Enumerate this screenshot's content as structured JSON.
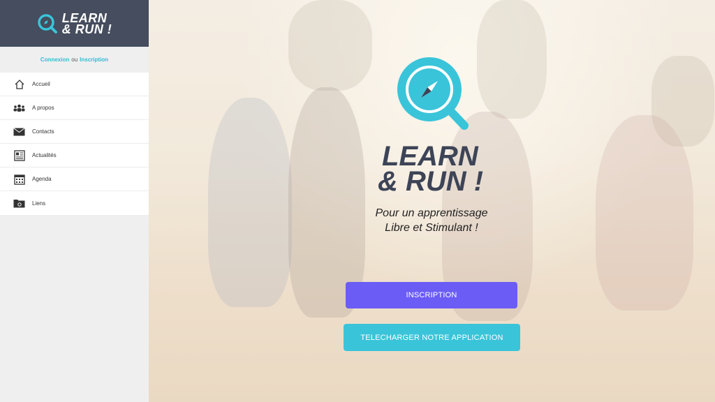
{
  "brand": {
    "line1": "LEARN",
    "line2": "& RUN !"
  },
  "auth": {
    "login": "Connexion",
    "or": "ou",
    "register": "Inscription"
  },
  "nav": [
    {
      "label": "Accueil",
      "icon": "home-icon"
    },
    {
      "label": "A propos",
      "icon": "users-icon"
    },
    {
      "label": "Contacts",
      "icon": "envelope-icon"
    },
    {
      "label": "Actualités",
      "icon": "newspaper-icon"
    },
    {
      "label": "Agenda",
      "icon": "calendar-icon"
    },
    {
      "label": "Liens",
      "icon": "folder-link-icon"
    }
  ],
  "hero": {
    "title_line1": "LEARN",
    "title_line2": "& RUN !",
    "tagline_line1": "Pour un apprentissage",
    "tagline_line2": "Libre et Stimulant !",
    "inscription_button": "INSCRIPTION",
    "download_button": "TELECHARGER NOTRE APPLICATION"
  },
  "colors": {
    "sidebar_header": "#454d5e",
    "accent_cyan": "#3ac4d9",
    "accent_purple": "#6b5cf6",
    "title_dark": "#3d4457"
  }
}
